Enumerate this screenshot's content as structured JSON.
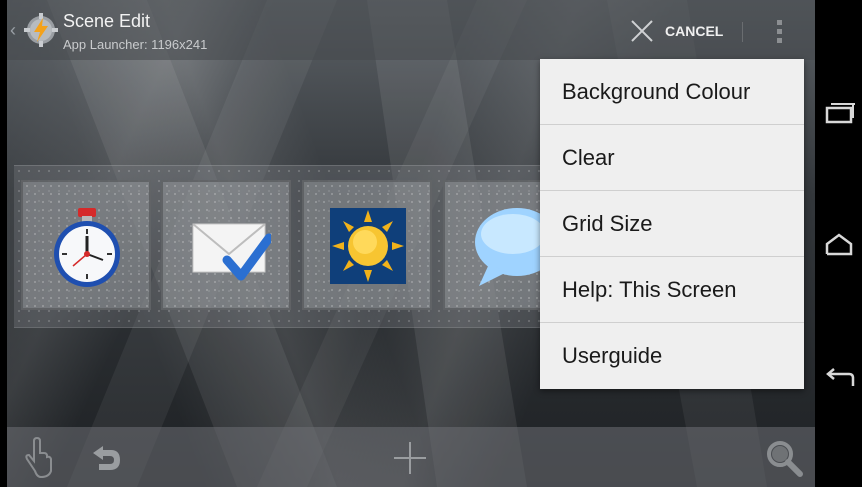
{
  "actionbar": {
    "title": "Scene Edit",
    "subtitle": "App Launcher: 1196x241",
    "cancel_label": "CANCEL",
    "icons": [
      "back-caret-icon",
      "tasker-app-icon",
      "close-icon",
      "overflow-menu-icon"
    ]
  },
  "scene": {
    "cells": [
      {
        "icon": "stopwatch-icon"
      },
      {
        "icon": "mail-check-icon"
      },
      {
        "icon": "sun-weather-icon"
      },
      {
        "icon": "speech-bubble-icon"
      }
    ]
  },
  "menu": {
    "items": [
      "Background Colour",
      "Clear",
      "Grid Size",
      "Help: This Screen",
      "Userguide"
    ]
  },
  "bottombar": {
    "icons": [
      "hand-touch-icon",
      "undo-icon",
      "add-icon",
      "magnify-icon"
    ]
  },
  "navbar": {
    "icons": [
      "recent-apps-icon",
      "home-icon",
      "back-icon"
    ]
  },
  "colors": {
    "menu_background": "#efefef",
    "menu_text": "#1a1a1a",
    "actionbar_text": "#f2f2f2",
    "navbar_background": "#000000"
  }
}
